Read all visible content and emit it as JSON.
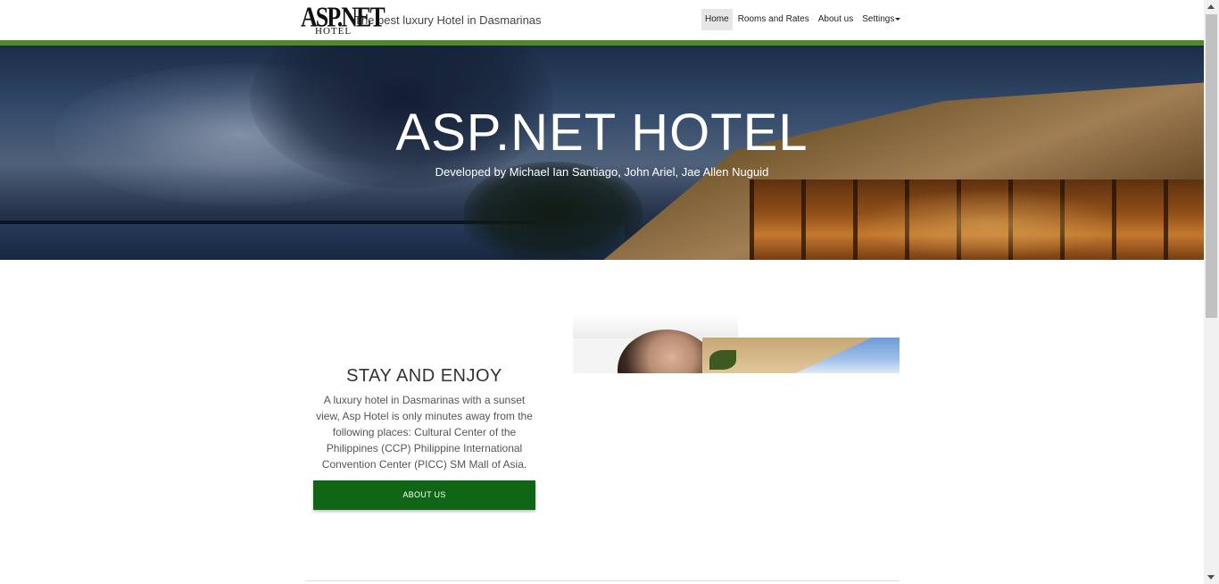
{
  "header": {
    "logo_top": "ASP.NET",
    "logo_bottom": "HOTEL",
    "tagline": "The best luxury Hotel in Dasmarinas",
    "nav": [
      {
        "label": "Home",
        "active": true
      },
      {
        "label": "Rooms and Rates",
        "active": false
      },
      {
        "label": "About us",
        "active": false
      },
      {
        "label": "Settings",
        "active": false,
        "dropdown": true
      }
    ]
  },
  "hero": {
    "title": "ASP.NET HOTEL",
    "subtitle": "Developed by Michael Ian Santiago, John Ariel, Jae Allen Nuguid"
  },
  "feature": {
    "title": "STAY AND ENJOY",
    "text": "A luxury hotel in Dasmarinas with a sunset view, Asp Hotel is only minutes away from the following places: Cultural Center of the Philippines (CCP) Philippine International Convention Center (PICC) SM Mall of Asia.",
    "button_label": "ABOUT US"
  },
  "colors": {
    "accent_bar": "#4f8a2a",
    "button_bg": "#0f6614"
  }
}
